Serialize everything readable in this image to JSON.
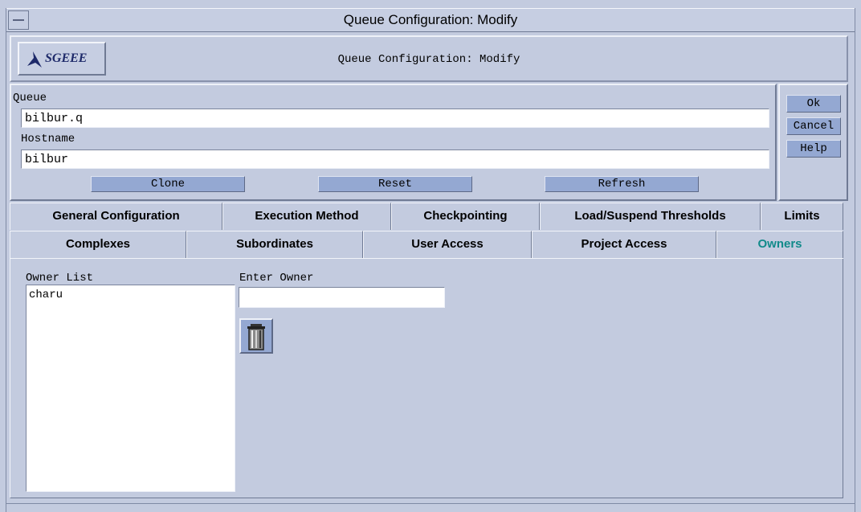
{
  "window": {
    "title": "Queue Configuration: Modify"
  },
  "header": {
    "logo_text": "SGEEE",
    "title": "Queue Configuration: Modify"
  },
  "form": {
    "queue_label": "Queue",
    "queue_value": "bilbur.q",
    "hostname_label": "Hostname",
    "hostname_value": "bilbur",
    "clone_label": "Clone",
    "reset_label": "Reset",
    "refresh_label": "Refresh"
  },
  "side_buttons": {
    "ok": "Ok",
    "cancel": "Cancel",
    "help": "Help"
  },
  "tabs": {
    "row1": [
      "General Configuration",
      "Execution Method",
      "Checkpointing",
      "Load/Suspend Thresholds",
      "Limits"
    ],
    "row2": [
      "Complexes",
      "Subordinates",
      "User Access",
      "Project Access",
      "Owners"
    ],
    "active": "Owners"
  },
  "owners": {
    "list_label": "Owner List",
    "entries": [
      "charu"
    ],
    "enter_label": "Enter Owner",
    "enter_value": ""
  },
  "colors": {
    "active_tab": "#118a8a",
    "background": "#c3cbdf",
    "button": "#94a8d2"
  },
  "icons": {
    "window_menu": "window-menu-icon",
    "logo": "sgeee-bird-logo-icon",
    "delete": "trash-icon"
  }
}
